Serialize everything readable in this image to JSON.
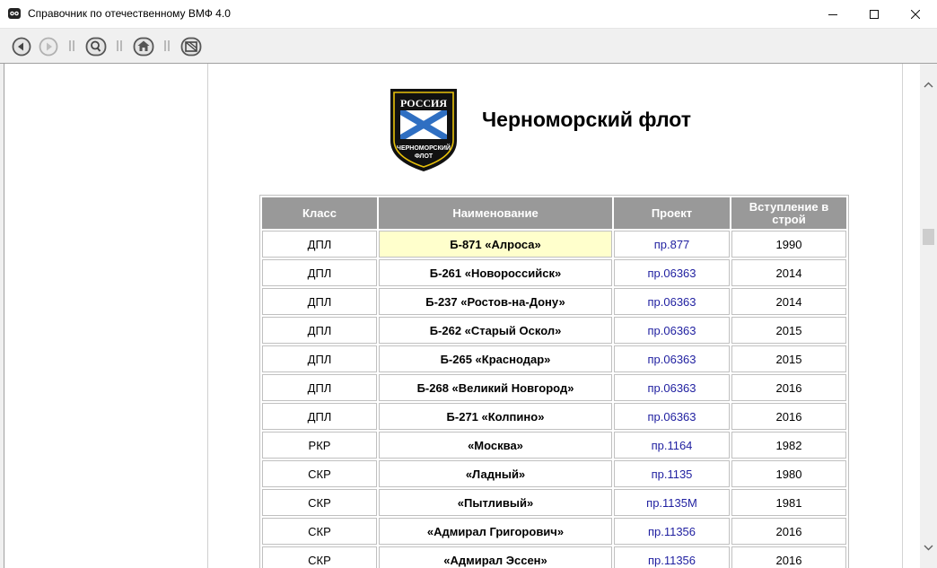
{
  "window": {
    "title": "Справочник по отечественному ВМФ 4.0"
  },
  "toolbar": {
    "buttons": [
      "back-icon",
      "forward-icon",
      "search-icon",
      "home-icon",
      "exit-icon"
    ]
  },
  "page": {
    "title": "Черноморский флот",
    "emblem_top": "РОССИЯ",
    "emblem_bottom_1": "ЧЕРНОМОРСКИЙ",
    "emblem_bottom_2": "ФЛОТ"
  },
  "table": {
    "headers": [
      "Класс",
      "Наименование",
      "Проект",
      "Вступление в строй"
    ],
    "rows": [
      {
        "class": "ДПЛ",
        "name": "Б-871 «Алроса»",
        "project": "пр.877",
        "year": "1990"
      },
      {
        "class": "ДПЛ",
        "name": "Б-261 «Новороссийск»",
        "project": "пр.06363",
        "year": "2014"
      },
      {
        "class": "ДПЛ",
        "name": "Б-237 «Ростов-на-Дону»",
        "project": "пр.06363",
        "year": "2014"
      },
      {
        "class": "ДПЛ",
        "name": "Б-262 «Старый Оскол»",
        "project": "пр.06363",
        "year": "2015"
      },
      {
        "class": "ДПЛ",
        "name": "Б-265 «Краснодар»",
        "project": "пр.06363",
        "year": "2015"
      },
      {
        "class": "ДПЛ",
        "name": "Б-268 «Великий Новгород»",
        "project": "пр.06363",
        "year": "2016"
      },
      {
        "class": "ДПЛ",
        "name": "Б-271 «Колпино»",
        "project": "пр.06363",
        "year": "2016"
      },
      {
        "class": "РКР",
        "name": "«Москва»",
        "project": "пр.1164",
        "year": "1982"
      },
      {
        "class": "СКР",
        "name": "«Ладный»",
        "project": "пр.1135",
        "year": "1980"
      },
      {
        "class": "СКР",
        "name": "«Пытливый»",
        "project": "пр.1135М",
        "year": "1981"
      },
      {
        "class": "СКР",
        "name": "«Адмирал Григорович»",
        "project": "пр.11356",
        "year": "2016"
      },
      {
        "class": "СКР",
        "name": "«Адмирал Эссен»",
        "project": "пр.11356",
        "year": "2016"
      }
    ]
  },
  "colors": {
    "header_bg": "#999999",
    "link": "#1f1fa0",
    "highlight": "#ffffcc"
  }
}
